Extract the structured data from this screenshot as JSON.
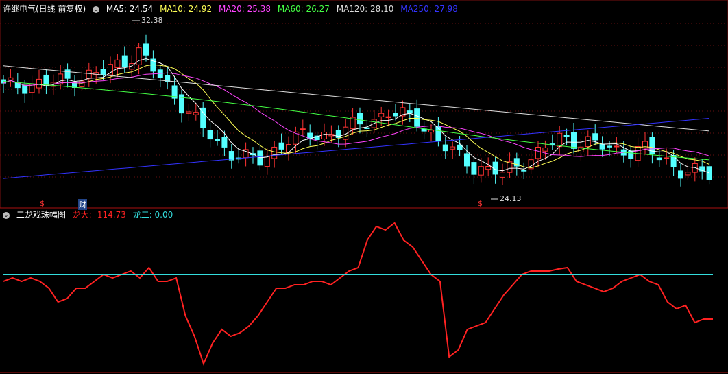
{
  "header": {
    "title": "许继电气(日线 前复权)",
    "ma": [
      {
        "label": "MA5: 24.54",
        "color": "#ffffff"
      },
      {
        "label": "MA10: 24.92",
        "color": "#ffff55"
      },
      {
        "label": "MA20: 25.38",
        "color": "#ff44ff"
      },
      {
        "label": "MA60: 26.27",
        "color": "#44ff44"
      },
      {
        "label": "MA120: 28.10",
        "color": "#dddddd"
      },
      {
        "label": "MA250: 27.98",
        "color": "#3333ff"
      }
    ]
  },
  "indicator": {
    "title": "二龙戏珠幅图",
    "long_big_label": "龙大: -114.73",
    "long_two_label": "龙二: 0.00",
    "long_big_color": "#ff2222",
    "long_two_color": "#33dddd"
  },
  "annotations": {
    "high_label": "32.38",
    "low_label": "24.13",
    "markers": [
      {
        "text": "$",
        "color": "#ff3333"
      },
      {
        "text": "财",
        "color": "#ffffff"
      },
      {
        "text": "$",
        "color": "#ff3333"
      }
    ]
  },
  "chart_data": {
    "type": "line",
    "price_range": [
      22.5,
      33.5
    ],
    "candles_approx_count": 100,
    "indicator_series": {
      "name": "龙大",
      "values": [
        -10,
        -5,
        -10,
        -5,
        -10,
        -20,
        -40,
        -35,
        -20,
        -20,
        -10,
        0,
        -5,
        0,
        5,
        -5,
        10,
        -10,
        -10,
        -5,
        -60,
        -90,
        -130,
        -100,
        -80,
        -90,
        -85,
        -75,
        -60,
        -40,
        -20,
        -20,
        -15,
        -15,
        -10,
        -10,
        -15,
        -5,
        5,
        10,
        50,
        70,
        65,
        75,
        50,
        40,
        20,
        0,
        -10,
        -120,
        -110,
        -80,
        -75,
        -70,
        -50,
        -30,
        -15,
        0,
        5,
        5,
        5,
        8,
        10,
        -10,
        -15,
        -20,
        -25,
        -20,
        -10,
        -5,
        0,
        -10,
        -15,
        -40,
        -50,
        -45,
        -70,
        -65,
        -65
      ],
      "baseline": 0
    }
  }
}
